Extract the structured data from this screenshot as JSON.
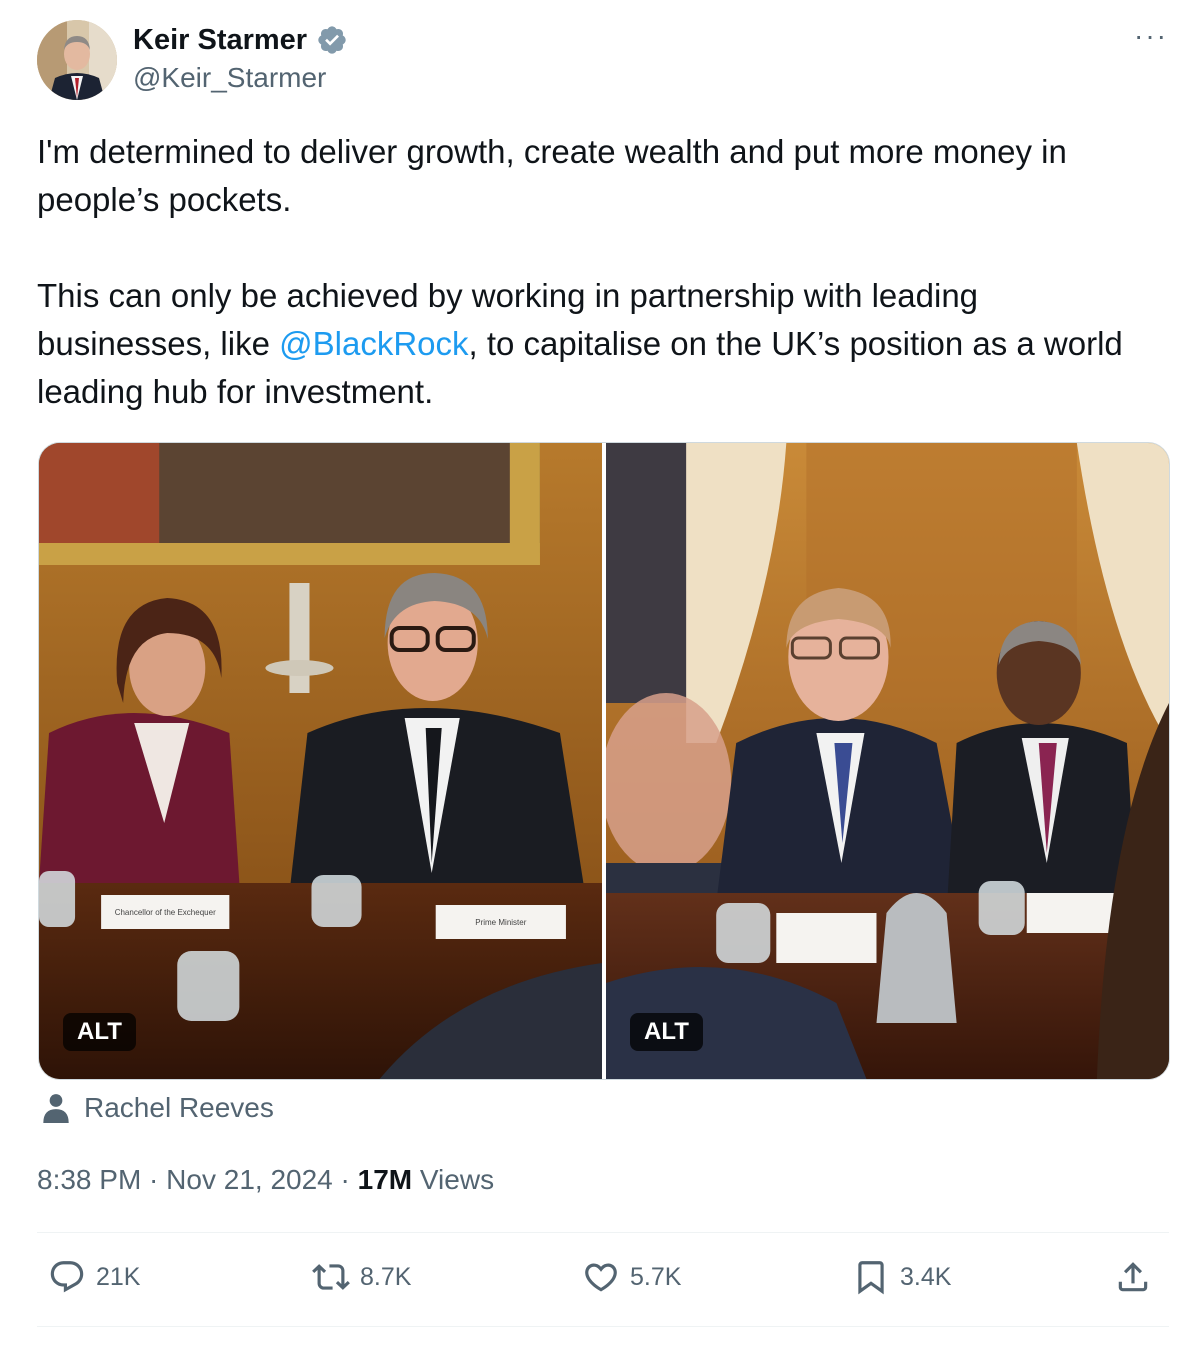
{
  "author": {
    "display_name": "Keir Starmer",
    "handle": "@Keir_Starmer",
    "verified_icon": "verified-badge-icon"
  },
  "more_label": "···",
  "tweet_text": {
    "line1": "I'm determined to deliver growth, create wealth and put more money in people’s pockets.",
    "para2_before": "This can only be achieved by working in partnership with leading businesses, like ",
    "mention": "@BlackRock",
    "para2_after": ", to capitalise on the UK’s position as a world leading hub for investment."
  },
  "media": {
    "photo1_alt_label": "ALT",
    "photo2_alt_label": "ALT",
    "nameplate1": "Chancellor of the Exchequer",
    "nameplate2": "Prime Minister"
  },
  "tagged_person": "Rachel Reeves",
  "timestamp": {
    "time": "8:38 PM",
    "sep1": " · ",
    "date": "Nov 21, 2024",
    "sep2": " · ",
    "views_count": "17M",
    "views_label": " Views"
  },
  "actions": {
    "replies": "21K",
    "reposts": "8.7K",
    "likes": "5.7K",
    "bookmarks": "3.4K"
  },
  "colors": {
    "link": "#1d9bf0",
    "secondary_text": "#536471",
    "primary_text": "#0f1419",
    "verified": "#829aab"
  }
}
